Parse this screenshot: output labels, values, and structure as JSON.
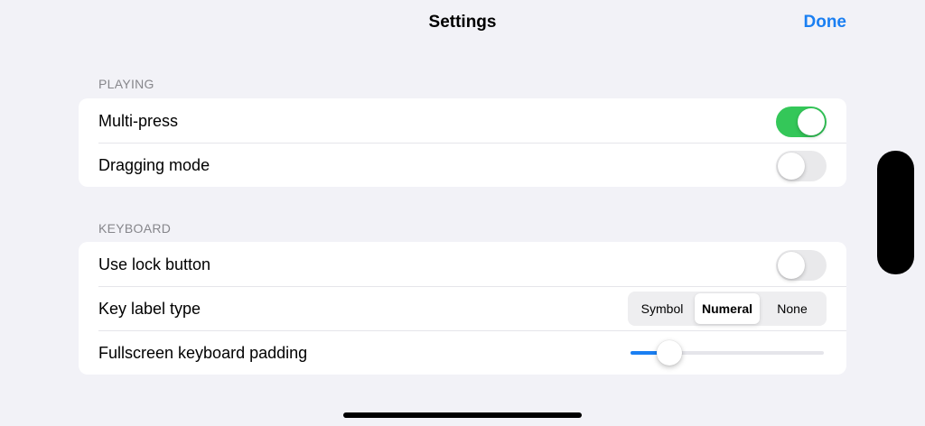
{
  "nav": {
    "title": "Settings",
    "done_label": "Done"
  },
  "sections": [
    {
      "header": "PLAYING",
      "rows": [
        {
          "label": "Multi-press",
          "toggle_on": true
        },
        {
          "label": "Dragging mode",
          "toggle_on": false
        }
      ]
    },
    {
      "header": "KEYBOARD",
      "rows": [
        {
          "label": "Use lock button",
          "toggle_on": false
        },
        {
          "label": "Key label type",
          "options": [
            "Symbol",
            "Numeral",
            "None"
          ],
          "selected": "Numeral"
        },
        {
          "label": "Fullscreen keyboard padding",
          "slider_value": 0.2
        }
      ]
    }
  ],
  "colors": {
    "accent": "#1a7ff2",
    "toggle_on": "#34c759",
    "background": "#f2f2f7"
  }
}
